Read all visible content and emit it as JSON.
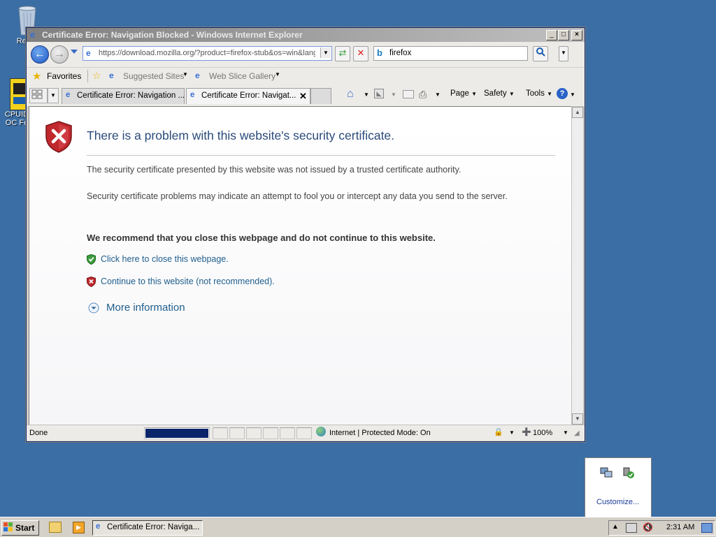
{
  "desktop": {
    "recycle_bin_label": "Recyc",
    "cpuid_label_1": "CPUID",
    "cpuid_label_2": "OC Fo"
  },
  "window": {
    "title": "Certificate Error: Navigation Blocked - Windows Internet Explorer",
    "controls": {
      "minimize": "_",
      "maximize": "□",
      "close": "×"
    }
  },
  "navbar": {
    "url": "https://download.mozilla.org/?product=firefox-stub&os=win&lang",
    "search_value": "firefox"
  },
  "favorites_bar": {
    "favorites_label": "Favorites",
    "items": [
      {
        "label": "Suggested Sites"
      },
      {
        "label": "Web Slice Gallery"
      }
    ]
  },
  "tabs": [
    {
      "label": "Certificate Error: Navigation ..."
    },
    {
      "label": "Certificate Error: Navigat..."
    }
  ],
  "command_bar": {
    "page_label": "Page",
    "safety_label": "Safety",
    "tools_label": "Tools"
  },
  "page": {
    "heading": "There is a problem with this website's security certificate.",
    "para1": "The security certificate presented by this website was not issued by a trusted certificate authority.",
    "para2": "Security certificate problems may indicate an attempt to fool you or intercept any data you send to the server.",
    "recommendation": "We recommend that you close this webpage and do not continue to this website.",
    "close_link": "Click here to close this webpage.",
    "continue_link": "Continue to this website (not recommended).",
    "more_info": "More information"
  },
  "statusbar": {
    "status_text": "Done",
    "progress": 1.0,
    "zone_text": "Internet | Protected Mode: On",
    "zoom": "100%"
  },
  "popup": {
    "customize_label": "Customize..."
  },
  "taskbar": {
    "start_label": "Start",
    "task_item_label": "Certificate Error: Naviga...",
    "clock": "2:31 AM"
  },
  "colors": {
    "desktop": "#3a6ea5",
    "link": "#1f5e8c",
    "heading": "#2b4a7a",
    "danger": "#c0282d",
    "safe": "#3b9c3b"
  }
}
